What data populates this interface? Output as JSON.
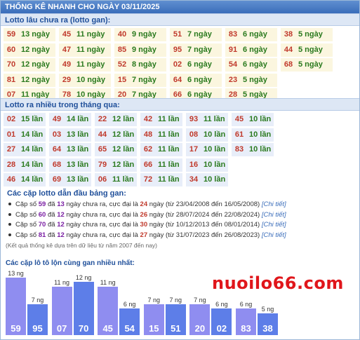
{
  "title": "THỐNG KÊ NHANH CHO NGÀY 03/11/2025",
  "gan_section": {
    "heading": "Lotto lâu chưa ra (lotto gan):",
    "rows": [
      [
        [
          "59",
          "13 ngày"
        ],
        [
          "45",
          "11 ngày"
        ],
        [
          "40",
          "9 ngày"
        ],
        [
          "51",
          "7 ngày"
        ],
        [
          "83",
          "6 ngày"
        ],
        [
          "38",
          "5 ngày"
        ]
      ],
      [
        [
          "60",
          "12 ngày"
        ],
        [
          "47",
          "11 ngày"
        ],
        [
          "85",
          "9 ngày"
        ],
        [
          "95",
          "7 ngày"
        ],
        [
          "91",
          "6 ngày"
        ],
        [
          "44",
          "5 ngày"
        ]
      ],
      [
        [
          "70",
          "12 ngày"
        ],
        [
          "49",
          "11 ngày"
        ],
        [
          "52",
          "8 ngày"
        ],
        [
          "02",
          "6 ngày"
        ],
        [
          "54",
          "6 ngày"
        ],
        [
          "68",
          "5 ngày"
        ]
      ],
      [
        [
          "81",
          "12 ngày"
        ],
        [
          "29",
          "10 ngày"
        ],
        [
          "15",
          "7 ngày"
        ],
        [
          "64",
          "6 ngày"
        ],
        [
          "23",
          "5 ngày"
        ]
      ],
      [
        [
          "07",
          "11 ngày"
        ],
        [
          "78",
          "10 ngày"
        ],
        [
          "20",
          "7 ngày"
        ],
        [
          "66",
          "6 ngày"
        ],
        [
          "28",
          "5 ngày"
        ]
      ]
    ]
  },
  "hot_section": {
    "heading": "Lotto ra nhiều trong tháng qua:",
    "rows": [
      [
        [
          "02",
          "15 lần"
        ],
        [
          "49",
          "14 lần"
        ],
        [
          "22",
          "12 lần"
        ],
        [
          "42",
          "11 lần"
        ],
        [
          "93",
          "11 lần"
        ],
        [
          "45",
          "10 lần"
        ]
      ],
      [
        [
          "01",
          "14 lần"
        ],
        [
          "03",
          "13 lần"
        ],
        [
          "44",
          "12 lần"
        ],
        [
          "48",
          "11 lần"
        ],
        [
          "08",
          "10 lần"
        ],
        [
          "61",
          "10 lần"
        ]
      ],
      [
        [
          "27",
          "14 lần"
        ],
        [
          "64",
          "13 lần"
        ],
        [
          "65",
          "12 lần"
        ],
        [
          "62",
          "11 lần"
        ],
        [
          "17",
          "10 lần"
        ],
        [
          "83",
          "10 lần"
        ]
      ],
      [
        [
          "28",
          "14 lần"
        ],
        [
          "68",
          "13 lần"
        ],
        [
          "79",
          "12 lần"
        ],
        [
          "66",
          "11 lần"
        ],
        [
          "16",
          "10 lần"
        ]
      ],
      [
        [
          "46",
          "14 lần"
        ],
        [
          "69",
          "13 lần"
        ],
        [
          "06",
          "11 lần"
        ],
        [
          "72",
          "11 lần"
        ],
        [
          "34",
          "10 lần"
        ]
      ]
    ]
  },
  "pairs_section": {
    "heading": "Các cặp lotto dẫn đầu bảng gan:",
    "items": [
      {
        "pair": "59",
        "days": "13",
        "max": "24",
        "from": "23/04/2008",
        "to": "16/05/2008"
      },
      {
        "pair": "60",
        "days": "12",
        "max": "26",
        "from": "28/07/2024",
        "to": "22/08/2024"
      },
      {
        "pair": "70",
        "days": "12",
        "max": "30",
        "from": "10/12/2013",
        "to": "08/01/2014"
      },
      {
        "pair": "81",
        "days": "12",
        "max": "27",
        "from": "31/07/2023",
        "to": "26/08/2023"
      }
    ],
    "text_prefix": "Cặp số",
    "text_da": "đã",
    "text_mid": "ngày chưa ra, cực đại là",
    "text_ngay": "ngày (từ",
    "text_den": "đến",
    "text_close": ")",
    "link_label": "[Chi tiết]",
    "note": "(Kết quả thống kê dựa trên dữ liệu từ năm 2007 đến nay)"
  },
  "chart_title": "Các cặp lô tô lộn cùng gan nhiều nhất:",
  "watermark": "nuoilo66.com",
  "chart_data": {
    "type": "bar",
    "groups": [
      [
        {
          "num": "59",
          "days": 13,
          "label": "13 ng"
        },
        {
          "num": "95",
          "days": 7,
          "label": "7 ng"
        }
      ],
      [
        {
          "num": "07",
          "days": 11,
          "label": "11 ng"
        },
        {
          "num": "70",
          "days": 12,
          "label": "12 ng"
        }
      ],
      [
        {
          "num": "45",
          "days": 11,
          "label": "11 ng"
        },
        {
          "num": "54",
          "days": 6,
          "label": "6 ng"
        }
      ],
      [
        {
          "num": "15",
          "days": 7,
          "label": "7 ng"
        },
        {
          "num": "51",
          "days": 7,
          "label": "7 ng"
        }
      ],
      [
        {
          "num": "20",
          "days": 7,
          "label": "7 ng"
        },
        {
          "num": "02",
          "days": 6,
          "label": "6 ng"
        }
      ],
      [
        {
          "num": "83",
          "days": 6,
          "label": "6 ng"
        },
        {
          "num": "38",
          "days": 5,
          "label": "5 ng"
        }
      ]
    ],
    "colors": {
      "first": "#8f8df0",
      "second": "#5d7ee8"
    }
  }
}
